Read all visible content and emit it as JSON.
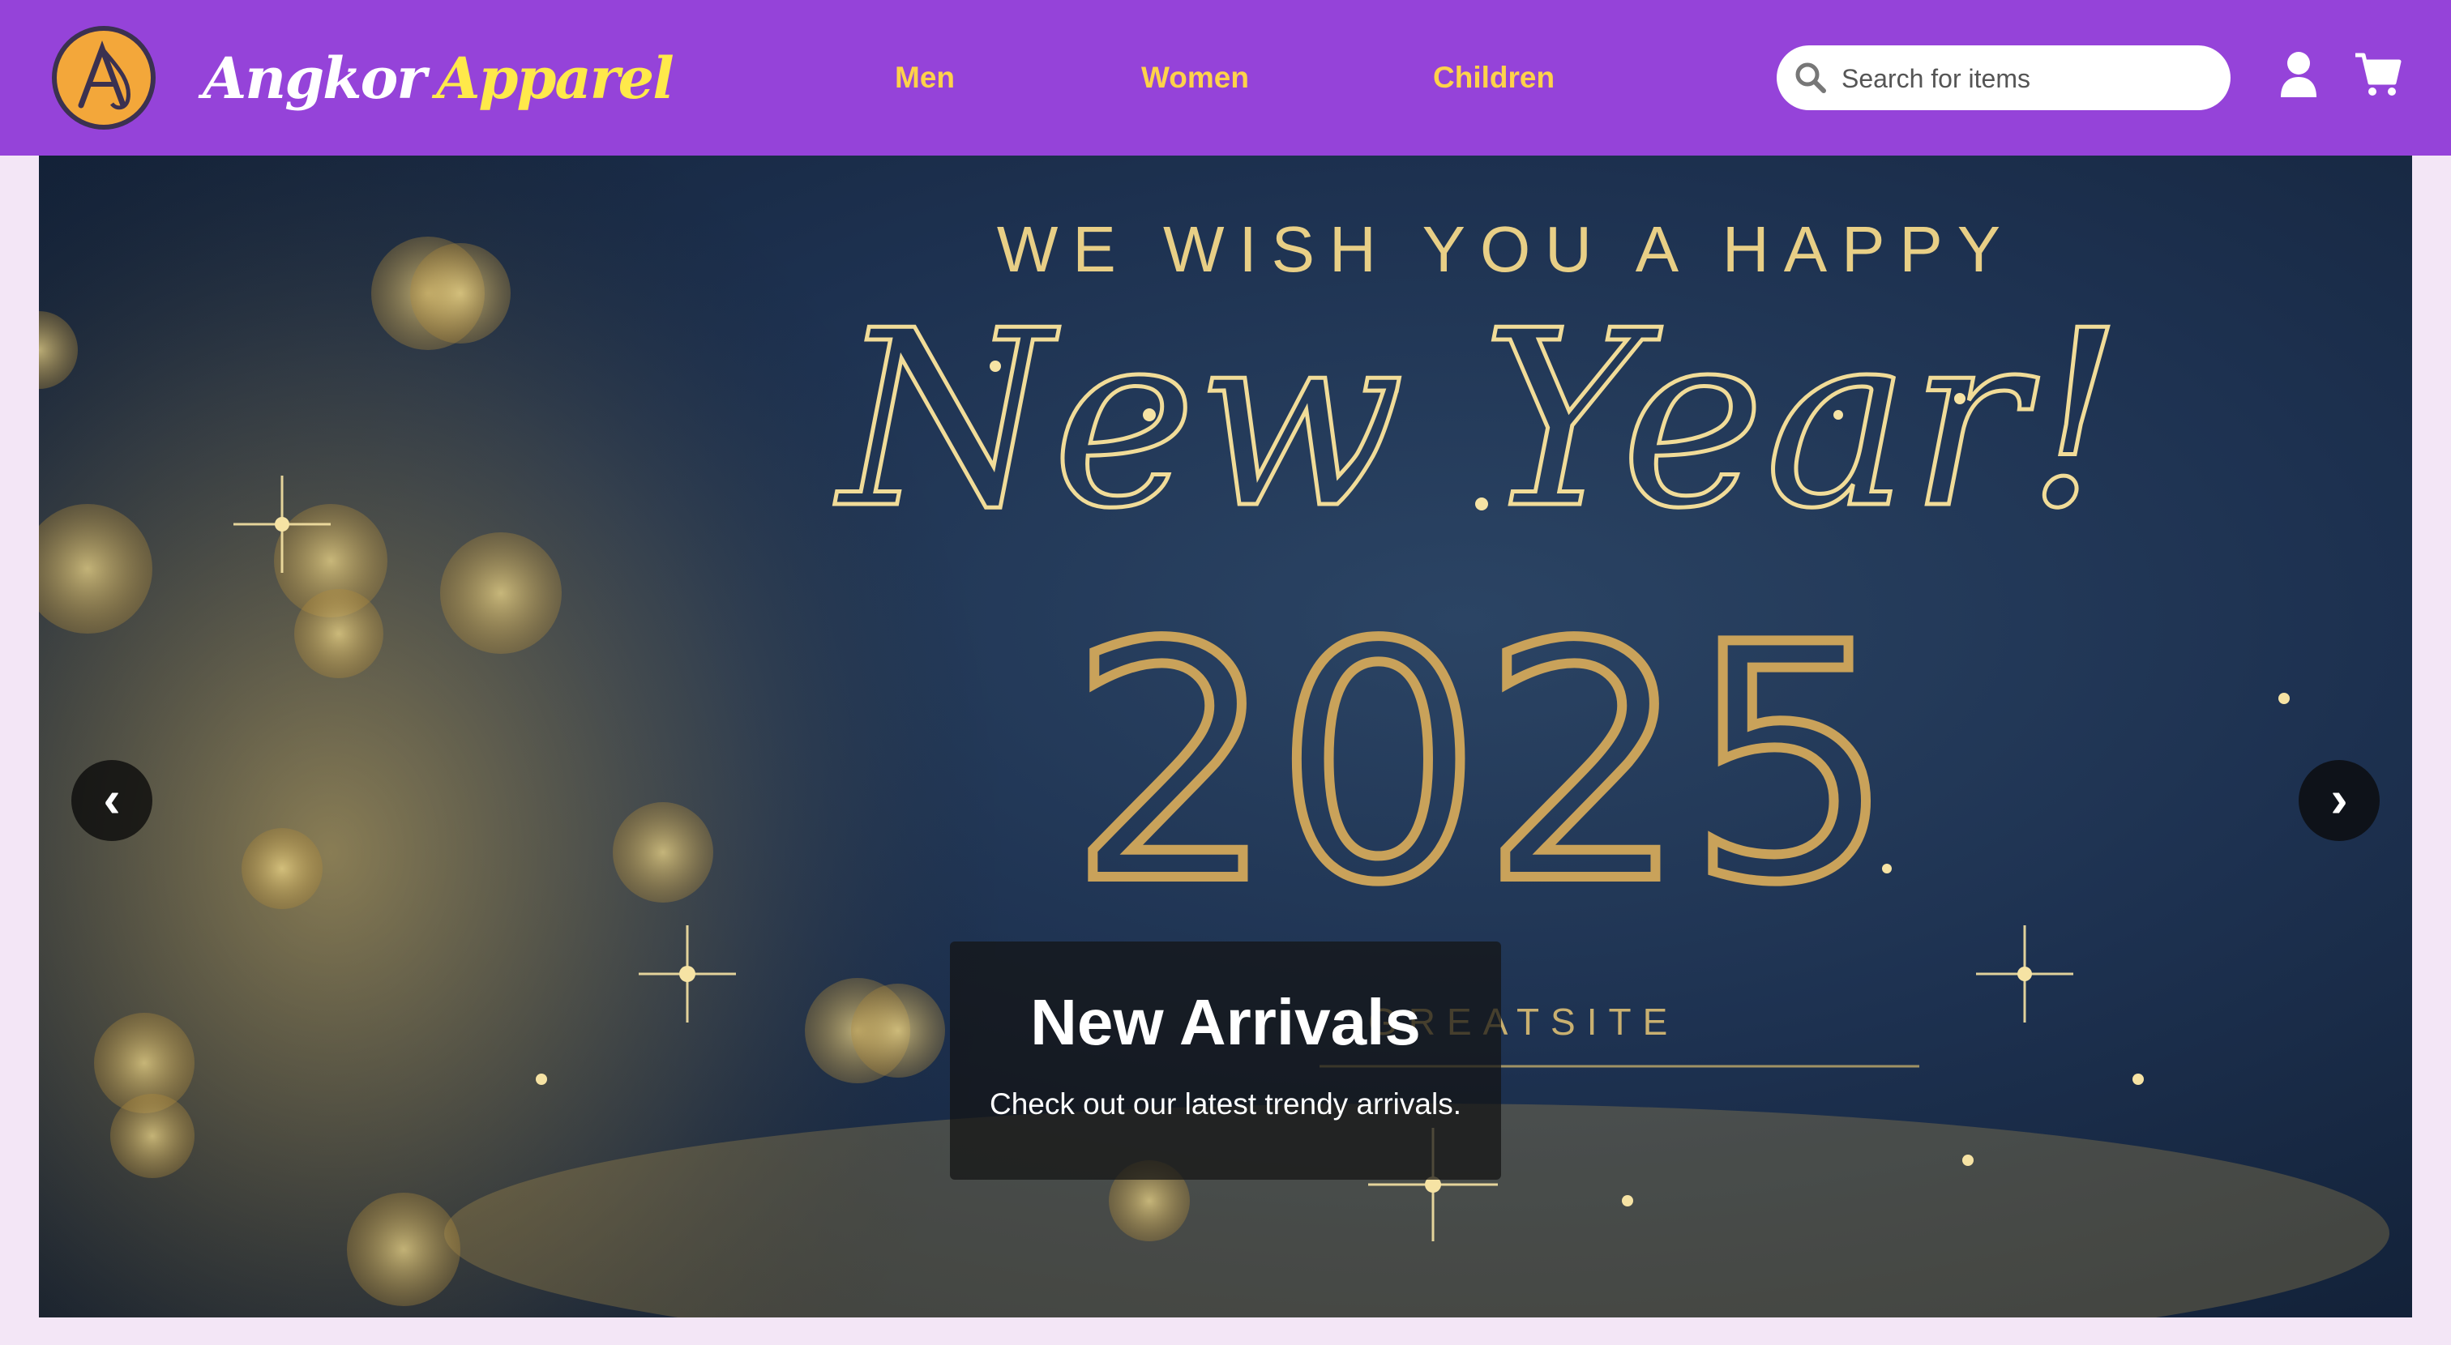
{
  "brand": {
    "part1": "Angkor",
    "part2": "Apparel",
    "logo_icon": "angkor-a-logo-icon"
  },
  "nav": [
    {
      "label": "Men"
    },
    {
      "label": "Women"
    },
    {
      "label": "Children"
    }
  ],
  "search": {
    "placeholder": "Search for items",
    "value": "",
    "icon": "search-icon"
  },
  "header_icons": {
    "account": "user-icon",
    "cart": "cart-icon"
  },
  "hero": {
    "tagline": "WE WISH YOU A HAPPY",
    "script_text": "New Year!",
    "year": "2025",
    "site_mark": "GREATSITE",
    "caption_title": "New Arrivals",
    "caption_text": "Check out our latest trendy arrivals.",
    "prev_label": "‹",
    "next_label": "›"
  },
  "colors": {
    "header_bg": "#9543d9",
    "nav_text": "#ffd24a",
    "brand_accent": "#ffe94a",
    "hero_bg": "#1d3150",
    "gold": "#e8cf86",
    "page_bg": "#f3e6f6"
  }
}
